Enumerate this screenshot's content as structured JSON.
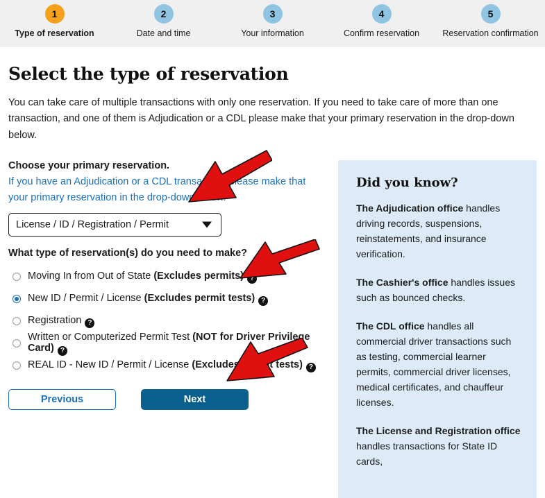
{
  "stepper": {
    "steps": [
      {
        "number": "1",
        "label": "Type of reservation",
        "active": true
      },
      {
        "number": "2",
        "label": "Date and time",
        "active": false
      },
      {
        "number": "3",
        "label": "Your information",
        "active": false
      },
      {
        "number": "4",
        "label": "Confirm reservation",
        "active": false
      },
      {
        "number": "5",
        "label": "Reservation confirmation",
        "active": false
      }
    ]
  },
  "page": {
    "title": "Select the type of reservation",
    "intro": "You can take care of multiple transactions with only one reservation. If you need to take care of more than one transaction, and one of them is Adjudication or a CDL please make that your primary reservation in the drop-down below."
  },
  "form": {
    "primary_label": "Choose your primary reservation.",
    "primary_help": "If you have an Adjudication or a CDL transaction, please make that your primary reservation in the drop-down below.",
    "select_value": "License / ID / Registration / Permit",
    "question": "What type of reservation(s) do you need to make?",
    "options": [
      {
        "text": "Moving In from Out of State ",
        "bold": "(Excludes permits)",
        "help": "?",
        "selected": false
      },
      {
        "text": "New ID / Permit / License ",
        "bold": "(Excludes permit tests)",
        "help": "?",
        "selected": true
      },
      {
        "text": "Registration",
        "bold": "",
        "help": "?",
        "selected": false
      },
      {
        "text": "Written or Computerized Permit Test ",
        "bold": "(NOT for Driver Privilege Card)",
        "help": "?",
        "selected": false
      },
      {
        "text": "REAL ID - New ID / Permit / License ",
        "bold": "(Excludes permit tests)",
        "help": "?",
        "selected": false
      }
    ]
  },
  "buttons": {
    "previous": "Previous",
    "next": "Next"
  },
  "sidebar": {
    "title": "Did you know?",
    "paragraphs": [
      {
        "lead": "The Adjudication office",
        "rest": " handles driving records, suspensions, reinstatements, and insurance verification."
      },
      {
        "lead": "The Cashier's office",
        "rest": " handles issues such as bounced checks."
      },
      {
        "lead": "The CDL office",
        "rest": " handles all commercial driver transactions such as testing, commercial learner permits, commercial driver licenses, medical certificates, and chauffeur licenses."
      },
      {
        "lead": "The License and Registration office",
        "rest": " handles transactions for State ID cards,"
      }
    ]
  },
  "annotations": {
    "arrow_color": "#e01010",
    "arrows": [
      {
        "name": "arrow-to-dropdown"
      },
      {
        "name": "arrow-to-selected-option"
      },
      {
        "name": "arrow-to-next-button"
      }
    ]
  },
  "colors": {
    "step_active": "#f5a11e",
    "step_inactive": "#8fc5e2",
    "link_blue": "#1b6fba",
    "panel_bg": "#dcebf7",
    "next_bg": "#09608f"
  }
}
